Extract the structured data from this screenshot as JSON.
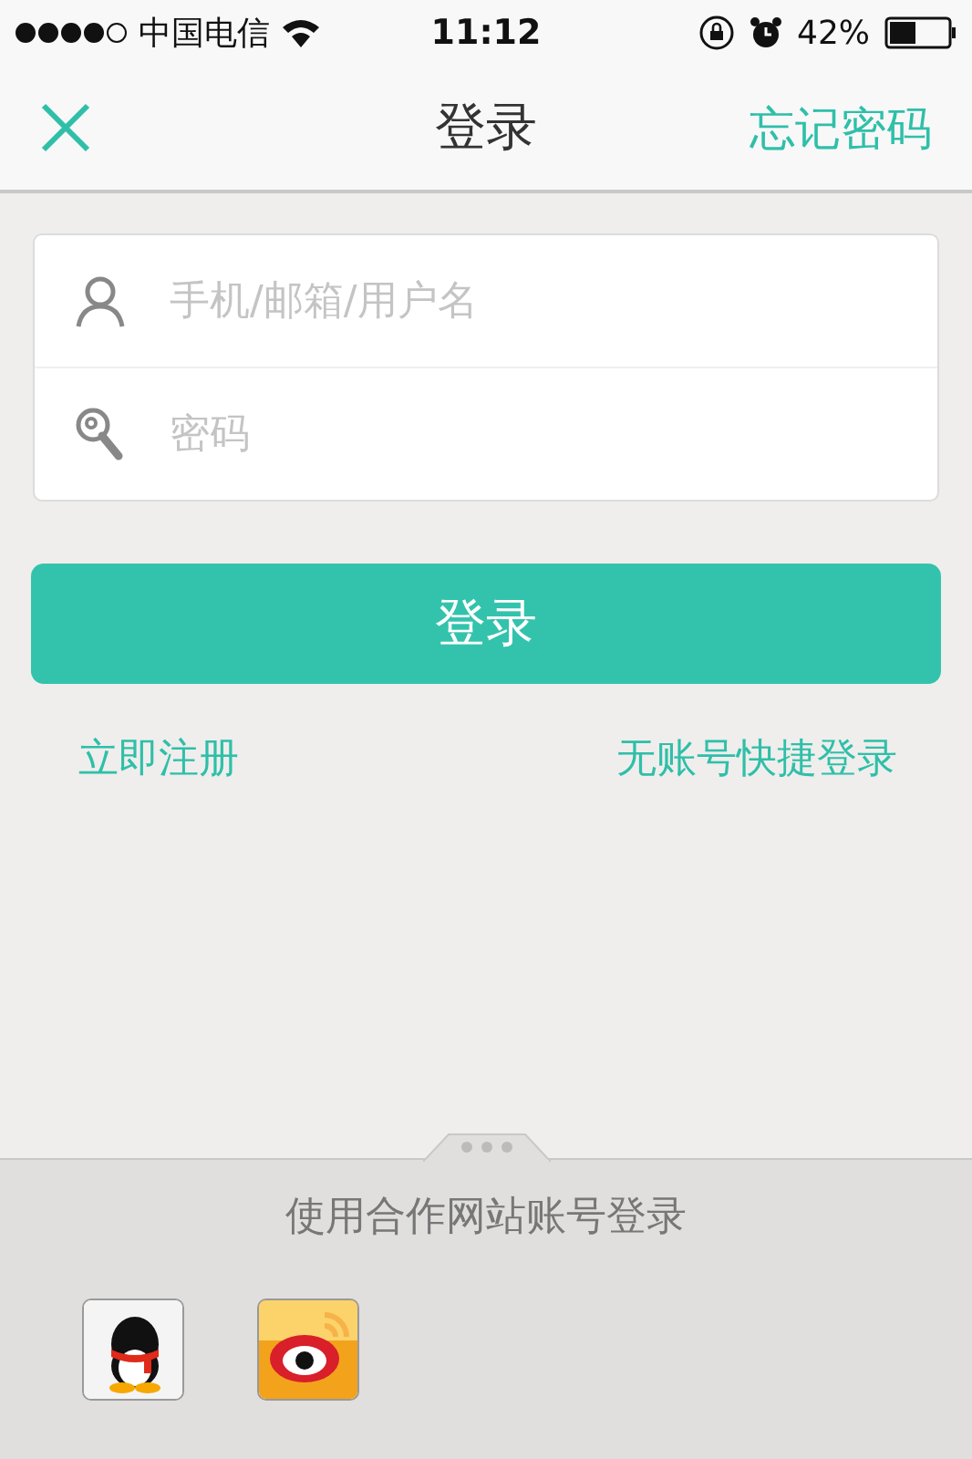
{
  "status_bar": {
    "carrier": "中国电信",
    "time": "11:12",
    "battery": "42%"
  },
  "nav": {
    "title": "登录",
    "right_link": "忘记密码"
  },
  "fields": [
    {
      "kind": "user",
      "placeholder": "手机/邮箱/用户名"
    },
    {
      "kind": "password",
      "placeholder": "密码"
    }
  ],
  "login_button": "登录",
  "links": [
    "立即注册",
    "无账号快捷登录"
  ],
  "partner": {
    "title": "使用合作网站账号登录"
  }
}
